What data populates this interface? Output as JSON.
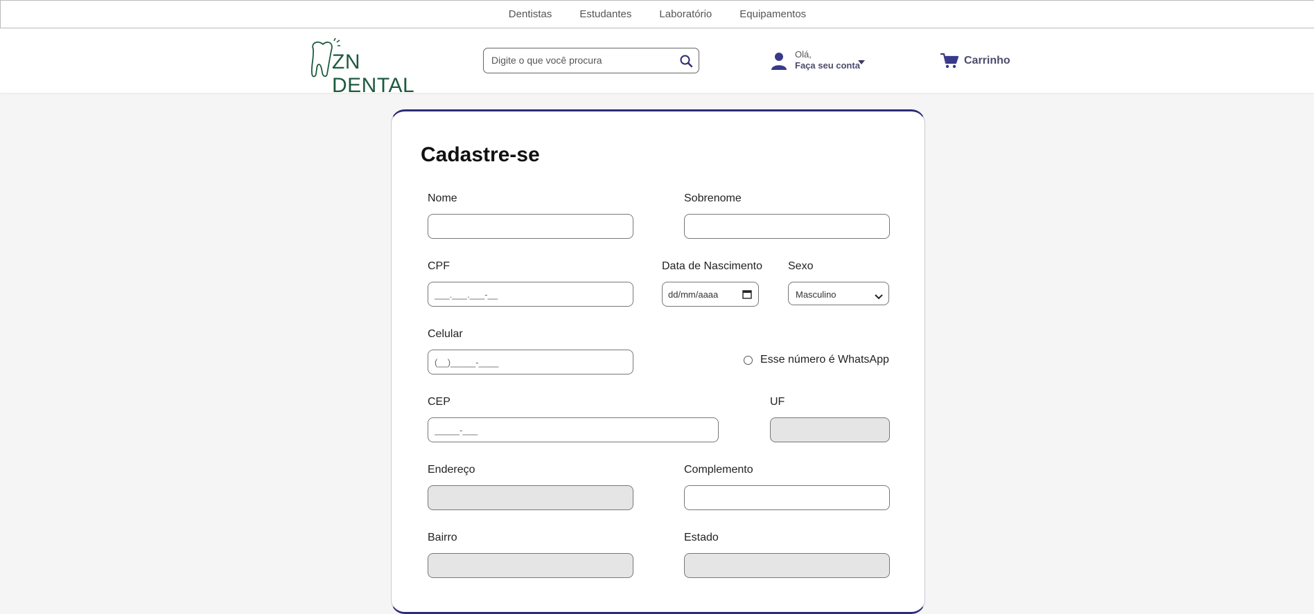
{
  "top_nav": [
    "Dentistas",
    "Estudantes",
    "Laboratório",
    "Equipamentos"
  ],
  "brand": {
    "name": "ZN DENTAL",
    "color": "#1c5a3e"
  },
  "search": {
    "placeholder": "Digite o que você procura",
    "icon": "search-icon"
  },
  "account": {
    "greeting": "Olá,",
    "cta": "Faça seu conta",
    "icon": "user-icon"
  },
  "cart": {
    "label": "Carrinho",
    "icon": "cart-icon"
  },
  "colors": {
    "accent": "#2b2b7a",
    "text_muted": "#4b4b6b",
    "disabled_bg": "#e5e5e5"
  },
  "form": {
    "title": "Cadastre-se",
    "nome": {
      "label": "Nome",
      "value": ""
    },
    "sobrenome": {
      "label": "Sobrenome",
      "value": ""
    },
    "cpf": {
      "label": "CPF",
      "placeholder": "___.___.___-__"
    },
    "nascimento": {
      "label": "Data de Nascimento",
      "placeholder": "dd/mm/aaaa"
    },
    "sexo": {
      "label": "Sexo",
      "value": "Masculino"
    },
    "celular": {
      "label": "Celular",
      "placeholder": "(__)_____-____"
    },
    "whatsapp": {
      "label": "Esse número é WhatsApp",
      "checked": false
    },
    "cep": {
      "label": "CEP",
      "placeholder": "_____-___"
    },
    "uf": {
      "label": "UF",
      "value": ""
    },
    "endereco": {
      "label": "Endereço",
      "value": ""
    },
    "complemento": {
      "label": "Complemento",
      "value": ""
    },
    "bairro": {
      "label": "Bairro",
      "value": ""
    },
    "estado": {
      "label": "Estado",
      "value": ""
    }
  }
}
